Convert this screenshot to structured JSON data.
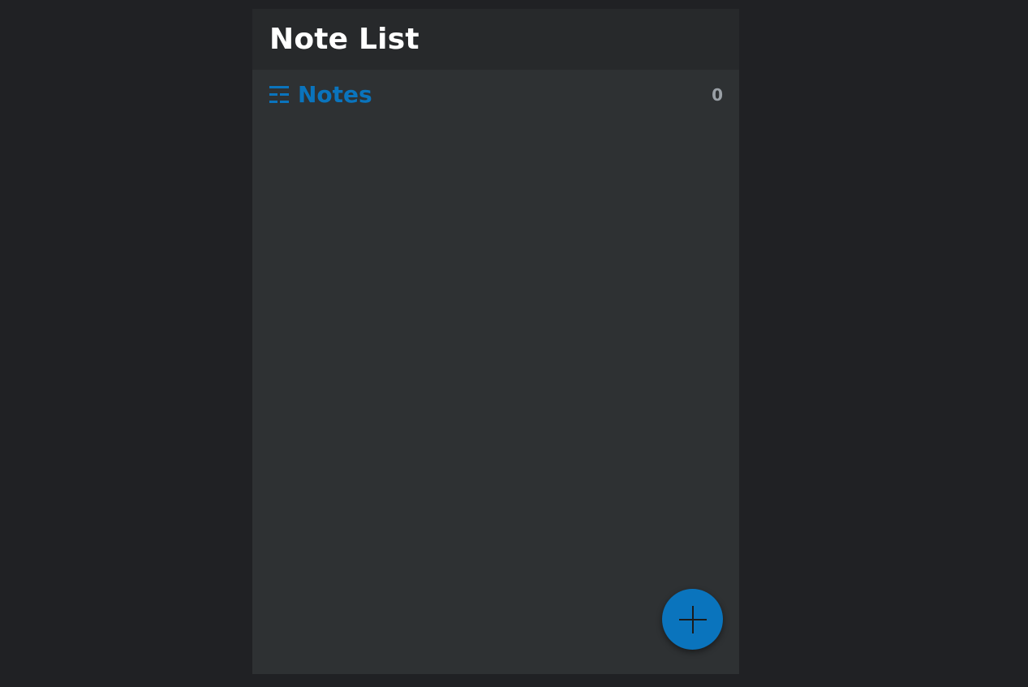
{
  "app": {
    "title": "Note List"
  },
  "list": {
    "icon": "list-icon",
    "title": "Notes",
    "count": "0"
  },
  "fab": {
    "icon": "plus-icon"
  },
  "colors": {
    "page_background": "#202124",
    "panel_background": "#2e3133",
    "header_background": "#27292b",
    "accent": "#0a74bd",
    "count_text": "#9aa0a6",
    "title_text": "#ffffff"
  }
}
